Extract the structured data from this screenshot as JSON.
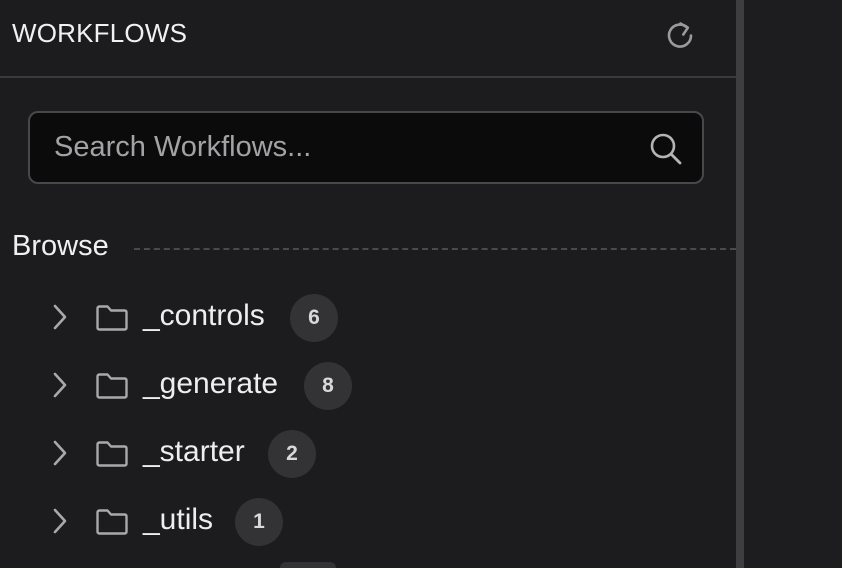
{
  "header": {
    "title": "WORKFLOWS",
    "refresh_icon": "refresh-icon"
  },
  "search": {
    "placeholder": "Search Workflows...",
    "value": "",
    "icon": "search-icon"
  },
  "browse": {
    "label": "Browse"
  },
  "tree": {
    "items": [
      {
        "name": "_controls",
        "count": "6",
        "expanded": false
      },
      {
        "name": "_generate",
        "count": "8",
        "expanded": false
      },
      {
        "name": "_starter",
        "count": "2",
        "expanded": false
      },
      {
        "name": "_utils",
        "count": "1",
        "expanded": false
      }
    ]
  },
  "colors": {
    "background": "#1c1c1e",
    "search_background": "#0b0b0c",
    "badge_background": "#333336",
    "text": "#eeeeee",
    "muted": "#a3a3a6"
  }
}
